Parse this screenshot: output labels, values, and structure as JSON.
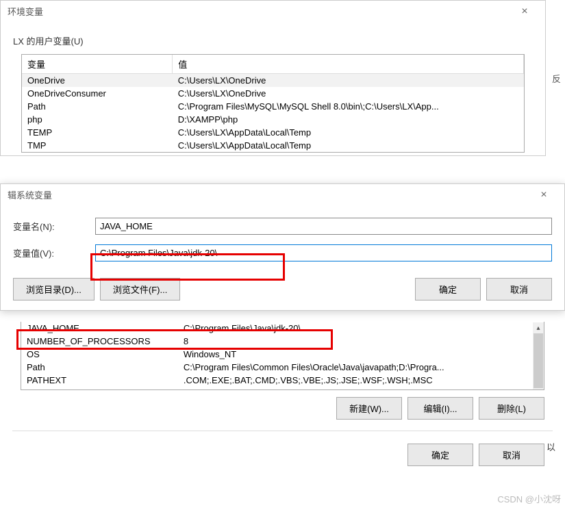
{
  "main_dialog": {
    "title": "环境变量",
    "close": "×",
    "user_section_label": "LX 的用户变量(U)",
    "columns": {
      "var": "变量",
      "val": "值"
    },
    "rows": [
      {
        "var": "OneDrive",
        "val": "C:\\Users\\LX\\OneDrive"
      },
      {
        "var": "OneDriveConsumer",
        "val": "C:\\Users\\LX\\OneDrive"
      },
      {
        "var": "Path",
        "val": "C:\\Program Files\\MySQL\\MySQL Shell 8.0\\bin\\;C:\\Users\\LX\\App..."
      },
      {
        "var": "php",
        "val": "D:\\XAMPP\\php"
      },
      {
        "var": "TEMP",
        "val": "C:\\Users\\LX\\AppData\\Local\\Temp"
      },
      {
        "var": "TMP",
        "val": "C:\\Users\\LX\\AppData\\Local\\Temp"
      }
    ]
  },
  "edit_dialog": {
    "title": "辑系统变量",
    "close": "×",
    "name_label": "变量名(N):",
    "value_label": "变量值(V):",
    "name_value": "JAVA_HOME",
    "value_value": "C:\\Program Files\\Java\\jdk-20\\",
    "browse_dir": "浏览目录(D)...",
    "browse_file": "浏览文件(F)...",
    "ok": "确定",
    "cancel": "取消"
  },
  "sys_section": {
    "rows": [
      {
        "var": "JAVA_HOME",
        "val": "C:\\Program Files\\Java\\jdk-20\\"
      },
      {
        "var": "NUMBER_OF_PROCESSORS",
        "val": "8"
      },
      {
        "var": "OS",
        "val": "Windows_NT"
      },
      {
        "var": "Path",
        "val": "C:\\Program Files\\Common Files\\Oracle\\Java\\javapath;D:\\Progra..."
      },
      {
        "var": "PATHEXT",
        "val": ".COM;.EXE;.BAT;.CMD;.VBS;.VBE;.JS;.JSE;.WSF;.WSH;.MSC"
      }
    ],
    "buttons": {
      "new": "新建(W)...",
      "edit": "编辑(I)...",
      "delete": "删除(L)"
    },
    "final_ok": "确定",
    "final_cancel": "取消"
  },
  "watermark": "CSDN @小沈呀",
  "outer_sidebar_text": "反",
  "outer_text": "以"
}
